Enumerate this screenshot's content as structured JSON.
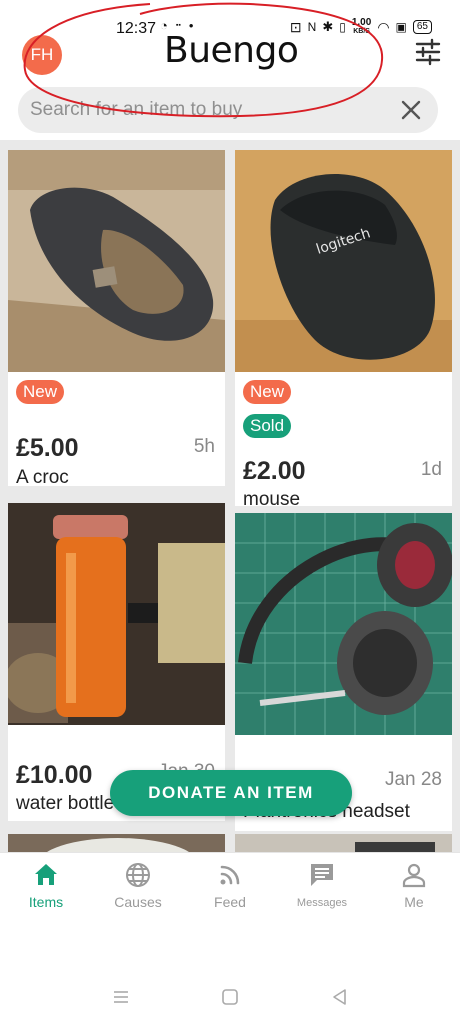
{
  "status_bar": {
    "time": "12:37",
    "speed": "1.00",
    "speed_unit": "KB/S",
    "battery": "65"
  },
  "header": {
    "avatar_initials": "FH",
    "logo": "Buengo",
    "search_placeholder": "Search for an item to buy"
  },
  "items": [
    {
      "badge_new": "New",
      "badge_sold": "",
      "price": "£5.00",
      "time": "5h",
      "title": "A croc"
    },
    {
      "badge_new": "New",
      "badge_sold": "Sold",
      "price": "£2.00",
      "time": "1d",
      "title": "mouse"
    },
    {
      "badge_new": "",
      "badge_sold": "",
      "price": "£10.00",
      "time": "Jan 30",
      "title": "water bottle"
    },
    {
      "badge_new": "",
      "badge_sold": "",
      "price": "",
      "time": "Jan 28",
      "title": "Plantronics headset"
    }
  ],
  "donate_button": "DONATE AN ITEM",
  "nav": {
    "items": "Items",
    "causes": "Causes",
    "feed": "Feed",
    "messages": "Messages",
    "me": "Me"
  },
  "colors": {
    "accent": "#17a07a",
    "new_badge": "#f36b4b",
    "avatar": "#f36b4b"
  }
}
